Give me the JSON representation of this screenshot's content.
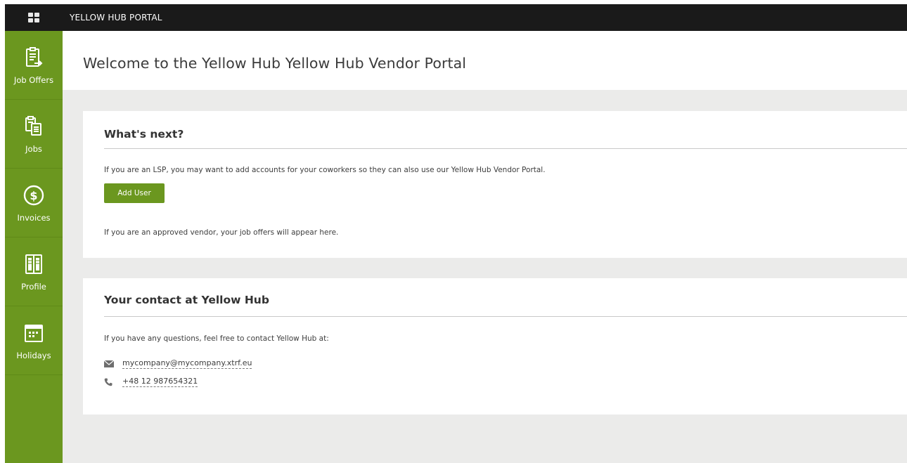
{
  "app": {
    "title": "YELLOW HUB PORTAL",
    "brand_color": "#6b971f",
    "topbar_color": "#1a1a1a",
    "menu_icon": "grid-menu-icon"
  },
  "sidebar": {
    "items": [
      {
        "label": "Job Offers",
        "icon": "job-offers-icon"
      },
      {
        "label": "Jobs",
        "icon": "jobs-icon"
      },
      {
        "label": "Invoices",
        "icon": "dollar-icon"
      },
      {
        "label": "Profile",
        "icon": "profile-icon"
      },
      {
        "label": "Holidays",
        "icon": "calendar-icon"
      }
    ]
  },
  "page": {
    "title": "Welcome to the Yellow Hub Yellow Hub Vendor Portal"
  },
  "whats_next": {
    "title": "What's next?",
    "lsp_text": "If you are an LSP, you may want to add accounts for your coworkers so they can also use our Yellow Hub Vendor Portal.",
    "add_user_label": "Add User",
    "vendor_text": "If you are an approved vendor, your job offers will appear here."
  },
  "contact": {
    "title": "Your contact at Yellow Hub",
    "intro": "If you have any questions, feel free to contact Yellow Hub at:",
    "email": "mycompany@mycompany.xtrf.eu",
    "phone": "+48 12 987654321",
    "email_icon": "envelope-icon",
    "phone_icon": "phone-icon"
  }
}
